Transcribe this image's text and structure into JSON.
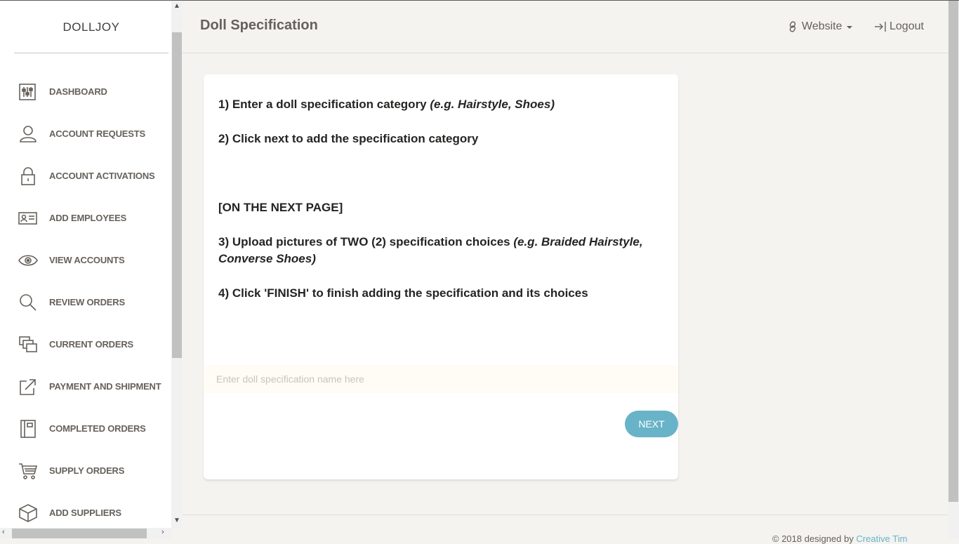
{
  "brand": "DOLLJOY",
  "sidebar": {
    "items": [
      {
        "label": "DASHBOARD",
        "icon": "dashboard-sliders-icon"
      },
      {
        "label": "ACCOUNT REQUESTS",
        "icon": "user-icon"
      },
      {
        "label": "ACCOUNT ACTIVATIONS",
        "icon": "lock-icon"
      },
      {
        "label": "ADD EMPLOYEES",
        "icon": "id-card-icon"
      },
      {
        "label": "VIEW ACCOUNTS",
        "icon": "eye-icon"
      },
      {
        "label": "REVIEW ORDERS",
        "icon": "search-icon"
      },
      {
        "label": "CURRENT ORDERS",
        "icon": "layers-icon"
      },
      {
        "label": "PAYMENT AND SHIPMENT",
        "icon": "share-icon"
      },
      {
        "label": "COMPLETED ORDERS",
        "icon": "notebook-icon"
      },
      {
        "label": "SUPPLY ORDERS",
        "icon": "cart-icon"
      },
      {
        "label": "ADD SUPPLIERS",
        "icon": "box-icon"
      }
    ]
  },
  "header": {
    "title": "Doll Specification",
    "website_label": "Website",
    "logout_label": "Logout"
  },
  "instructions": {
    "step1_text": "1) Enter a doll specification category ",
    "step1_example": "(e.g. Hairstyle, Shoes)",
    "step2_text": "2) Click next to add the specification category",
    "next_page_label": "[ON THE NEXT PAGE]",
    "step3_text": "3) Upload pictures of TWO (2) specification choices ",
    "step3_example": "(e.g. Braided Hairstyle, Converse Shoes)",
    "step4_text": "4) Click 'FINISH' to finish adding the specification and its choices"
  },
  "form": {
    "spec_name_placeholder": "Enter doll specification name here",
    "spec_name_value": "",
    "next_label": "NEXT"
  },
  "footer": {
    "prefix": "© 2018 designed by ",
    "link_text": "Creative Tim"
  },
  "colors": {
    "accent": "#68b3c8",
    "text": "#66615b",
    "background": "#f4f3ef",
    "input_bg": "#fffcf5"
  }
}
